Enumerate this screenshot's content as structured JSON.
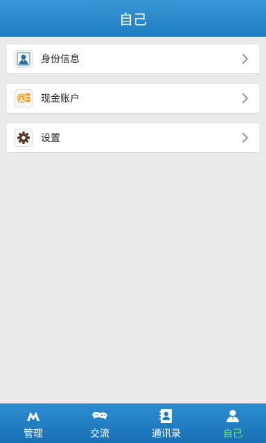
{
  "header": {
    "title": "自己"
  },
  "menu": {
    "items": [
      {
        "label": "身份信息",
        "icon": "identity-card-icon"
      },
      {
        "label": "现金账户",
        "icon": "cash-coins-icon"
      },
      {
        "label": "设置",
        "icon": "gear-icon"
      }
    ]
  },
  "tabbar": {
    "tabs": [
      {
        "label": "管理",
        "icon": "manage-logo-icon",
        "active": false
      },
      {
        "label": "交流",
        "icon": "chat-bubbles-icon",
        "active": false
      },
      {
        "label": "通讯录",
        "icon": "contacts-book-icon",
        "active": false
      },
      {
        "label": "自己",
        "icon": "person-icon",
        "active": true
      }
    ]
  },
  "colors": {
    "header_bg": "#2688cb",
    "active_tab": "#6df05a",
    "page_bg": "#ebebeb"
  }
}
